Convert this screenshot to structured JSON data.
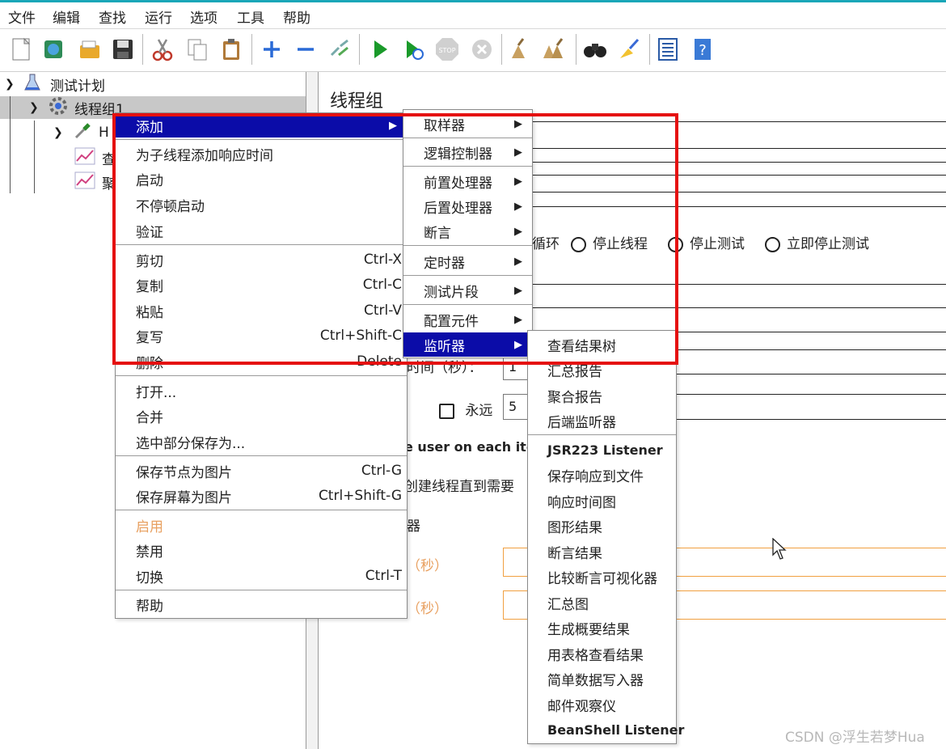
{
  "menubar": [
    "文件",
    "编辑",
    "查找",
    "运行",
    "选项",
    "工具",
    "帮助"
  ],
  "toolbar_icons": [
    "new-icon",
    "templates-icon",
    "open-icon",
    "save-icon",
    "cut-icon",
    "copy-icon",
    "paste-icon",
    "expand-icon",
    "collapse-icon",
    "toggle-icon",
    "start-icon",
    "start-no-pause-icon",
    "stop-icon",
    "shutdown-icon",
    "clear-icon",
    "clear-all-icon",
    "search-icon",
    "reset-search-icon",
    "function-helper-icon",
    "help-icon"
  ],
  "tree": {
    "root": "测试计划",
    "thread_group": "线程组1",
    "child_h": "H",
    "child_2": "查",
    "child_3": "聚"
  },
  "right_pane": {
    "title": "线程组",
    "loop_fragment": "循环",
    "radio_stop_thread": "停止线程",
    "radio_stop_test": "停止测试",
    "radio_stop_now": "立即停止测试",
    "ramp_fragment": "时间（秒）：",
    "ramp_value": "1",
    "forever_label": "永远",
    "loop_value": "5",
    "same_user_fragment": "e user on each itera",
    "delay_fragment": "创建线程直到需要",
    "scheduler_fragment": "器",
    "duration_fragment": "（秒）",
    "delay_fragment2": "（秒）"
  },
  "context_menu": {
    "items": [
      {
        "label": "添加",
        "submenu": true
      },
      {
        "label": "为子线程添加响应时间"
      },
      {
        "label": "启动"
      },
      {
        "label": "不停顿启动"
      },
      {
        "label": "验证"
      },
      {
        "label": "剪切",
        "acc": "Ctrl-X"
      },
      {
        "label": "复制",
        "acc": "Ctrl-C"
      },
      {
        "label": "粘贴",
        "acc": "Ctrl-V"
      },
      {
        "label": "复写",
        "acc": "Ctrl+Shift-C"
      },
      {
        "label": "删除",
        "acc": "Delete"
      },
      {
        "label": "打开..."
      },
      {
        "label": "合并"
      },
      {
        "label": "选中部分保存为..."
      },
      {
        "label": "保存节点为图片",
        "acc": "Ctrl-G"
      },
      {
        "label": "保存屏幕为图片",
        "acc": "Ctrl+Shift-G"
      },
      {
        "label": "启用"
      },
      {
        "label": "禁用"
      },
      {
        "label": "切换",
        "acc": "Ctrl-T"
      },
      {
        "label": "帮助"
      }
    ]
  },
  "add_submenu": [
    "取样器",
    "逻辑控制器",
    "前置处理器",
    "后置处理器",
    "断言",
    "定时器",
    "测试片段",
    "配置元件",
    "监听器"
  ],
  "listener_submenu": [
    "查看结果树",
    "汇总报告",
    "聚合报告",
    "后端监听器",
    "JSR223 Listener",
    "保存响应到文件",
    "响应时间图",
    "图形结果",
    "断言结果",
    "比较断言可视化器",
    "汇总图",
    "生成概要结果",
    "用表格查看结果",
    "简单数据写入器",
    "邮件观察仪",
    "BeanShell Listener"
  ],
  "watermark": "CSDN @浮生若梦Hua",
  "colors": {
    "highlight": "#0b0ca8",
    "disabled": "#e8a060",
    "annotation": "#e51010"
  }
}
